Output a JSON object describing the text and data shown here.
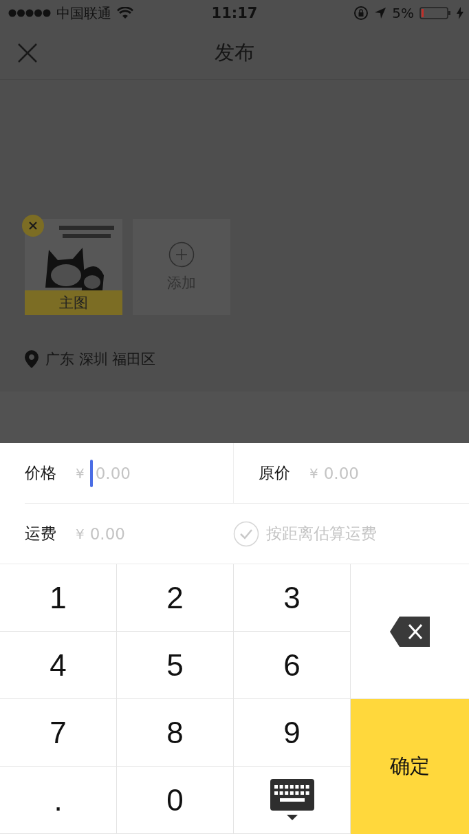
{
  "status_bar": {
    "carrier": "中国联通",
    "time": "11:17",
    "battery": "5%"
  },
  "nav": {
    "title": "发布"
  },
  "photos": [
    {
      "kind": "picture",
      "badge": "主图"
    }
  ],
  "add_tile": {
    "label": "添加"
  },
  "location": "广东 深圳 福田区",
  "form": {
    "price": {
      "label": "价格",
      "currency": "¥",
      "placeholder": "0.00",
      "focused": true
    },
    "original_price": {
      "label": "原价",
      "currency": "¥",
      "placeholder": "0.00",
      "focused": false
    },
    "shipping": {
      "label": "运费",
      "currency": "¥",
      "placeholder": "0.00",
      "focused": false
    },
    "estimate": {
      "label": "按距离估算运费",
      "checked": false
    }
  },
  "keypad": [
    {
      "kind": "digit",
      "label": "1"
    },
    {
      "kind": "digit",
      "label": "2"
    },
    {
      "kind": "digit",
      "label": "3"
    },
    {
      "kind": "backspace"
    },
    {
      "kind": "digit",
      "label": "4"
    },
    {
      "kind": "digit",
      "label": "5"
    },
    {
      "kind": "digit",
      "label": "6"
    },
    {
      "kind": "digit",
      "label": "7"
    },
    {
      "kind": "digit",
      "label": "8"
    },
    {
      "kind": "digit",
      "label": "9"
    },
    {
      "kind": "confirm",
      "label": "确定"
    },
    {
      "kind": "digit",
      "label": "."
    },
    {
      "kind": "digit",
      "label": "0"
    },
    {
      "kind": "hide"
    }
  ]
}
